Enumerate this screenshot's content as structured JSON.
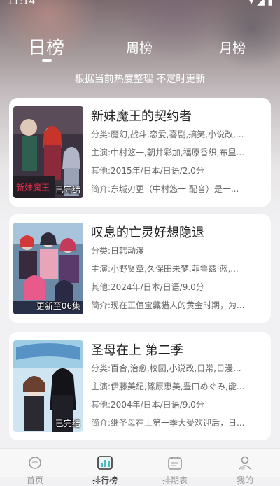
{
  "status": {
    "time": "11:14",
    "sys": "▾ ◢ ▮"
  },
  "tabs": [
    {
      "label": "日榜",
      "active": true
    },
    {
      "label": "周榜",
      "active": false
    },
    {
      "label": "月榜",
      "active": false
    }
  ],
  "subtitle": "根据当前热度整理 不定时更新",
  "cards": [
    {
      "title": "新妹魔王的契约者",
      "badge": "已完结",
      "rows": [
        {
          "k": "分类:",
          "v": "魔幻,战斗,恋爱,喜剧,搞笑,小说改,..."
        },
        {
          "k": "主演:",
          "v": "中村悠一,朝井彩加,福原香织,布里..."
        },
        {
          "k": "其他:",
          "v": "2015年/日本/日语/2.0分"
        },
        {
          "k": "简介:",
          "v": "东城刃更（中村悠一 配音）是一..."
        }
      ]
    },
    {
      "title": "叹息的亡灵好想隐退",
      "badge": "更新至06集",
      "rows": [
        {
          "k": "分类:",
          "v": "日韩动漫"
        },
        {
          "k": "主演:",
          "v": "小野贤章,久保田未梦,菲鲁兹·蓝,..."
        },
        {
          "k": "其他:",
          "v": "2024年/日本/日语/9.0分"
        },
        {
          "k": "简介:",
          "v": "现在正值宝藏猎人的黄金时期，为..."
        }
      ]
    },
    {
      "title": "圣母在上 第二季",
      "badge": "已完结",
      "rows": [
        {
          "k": "分类:",
          "v": "百合,治愈,校园,小说改,日常,日漫..."
        },
        {
          "k": "主演:",
          "v": "伊藤美紀,篠原恵美,豊口めぐみ,能..."
        },
        {
          "k": "其他:",
          "v": "2004年/日本/日语/9.0分"
        },
        {
          "k": "简介:",
          "v": "继圣母在上第一季大受欢迎后，日..."
        }
      ]
    }
  ],
  "tabbar": [
    {
      "label": "首页",
      "icon": "home-icon",
      "active": false
    },
    {
      "label": "排行榜",
      "icon": "ranking-icon",
      "active": true
    },
    {
      "label": "排期表",
      "icon": "calendar-icon",
      "active": false
    },
    {
      "label": "我的",
      "icon": "profile-icon",
      "active": false
    }
  ]
}
